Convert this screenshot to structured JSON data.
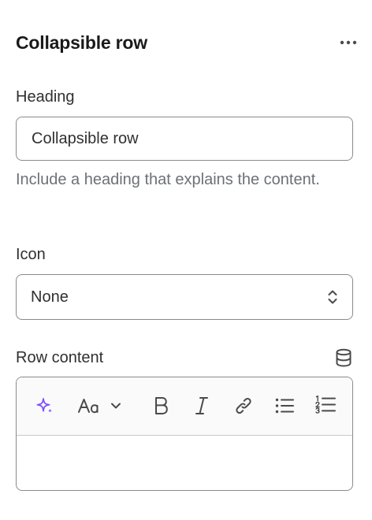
{
  "panel": {
    "title": "Collapsible row",
    "more_icon": "more-horizontal-icon"
  },
  "heading_field": {
    "label": "Heading",
    "value": "Collapsible row",
    "help_text": "Include a heading that explains the content."
  },
  "icon_field": {
    "label": "Icon",
    "selected": "None",
    "indicator_icon": "select-chevrons-icon"
  },
  "row_content": {
    "label": "Row content",
    "dynamic_source_icon": "database-icon",
    "toolbar": [
      {
        "name": "ai-sparkle",
        "icon": "sparkle-icon",
        "accent": "#8051ff"
      },
      {
        "name": "text-format",
        "icon": "text-format-icon",
        "dropdown": "chevron-down-icon"
      },
      {
        "name": "bold",
        "icon": "bold-icon"
      },
      {
        "name": "italic",
        "icon": "italic-icon"
      },
      {
        "name": "link",
        "icon": "link-icon"
      },
      {
        "name": "bulleted-list",
        "icon": "bulleted-list-icon"
      },
      {
        "name": "numbered-list",
        "icon": "numbered-list-icon"
      }
    ],
    "content": ""
  },
  "colors": {
    "text": "#303030",
    "muted": "#6d7175",
    "border": "#8a8a8a",
    "accent": "#8051ff"
  }
}
